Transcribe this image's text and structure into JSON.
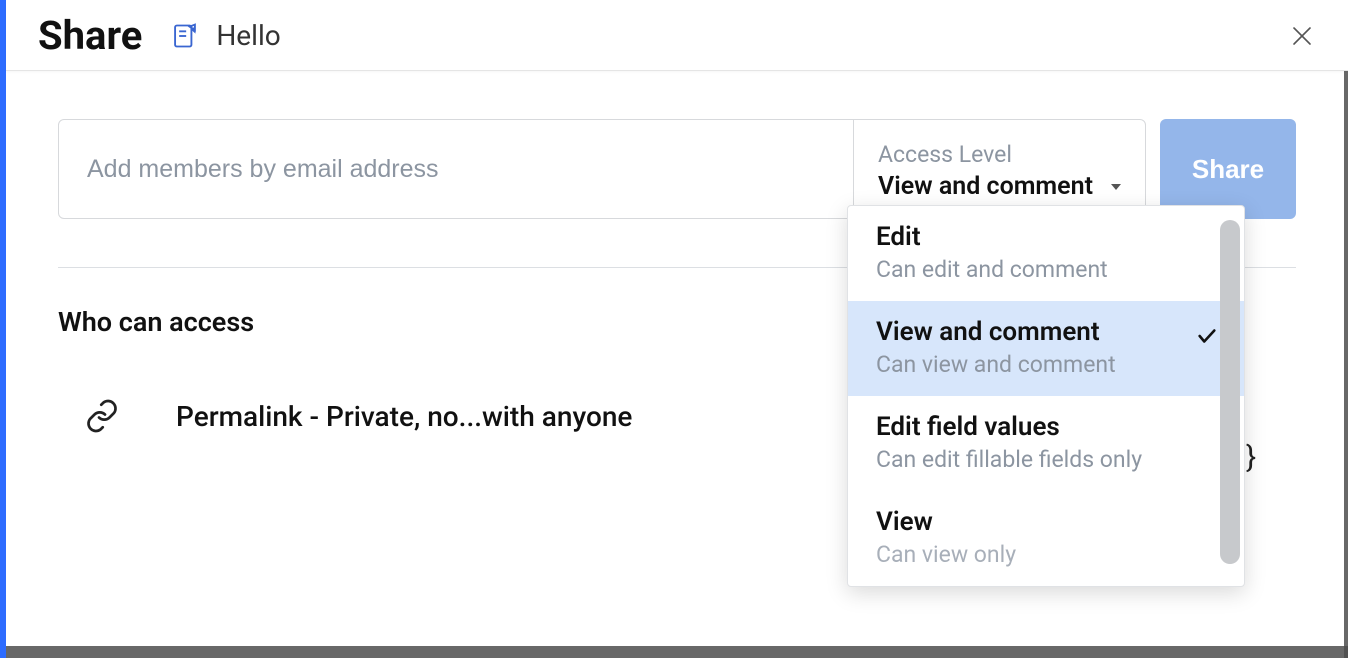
{
  "header": {
    "title": "Share",
    "doc_name": "Hello"
  },
  "input": {
    "placeholder": "Add members by email address",
    "access_label": "Access Level",
    "access_value": "View and comment"
  },
  "share_button": "Share",
  "who_label": "Who can access",
  "permalink": "Permalink - Private, no...with anyone",
  "dropdown": {
    "items": [
      {
        "title": "Edit",
        "desc": "Can edit and comment"
      },
      {
        "title": "View and comment",
        "desc": "Can view and comment"
      },
      {
        "title": "Edit field values",
        "desc": "Can edit fillable fields only"
      },
      {
        "title": "View",
        "desc": "Can view only"
      }
    ],
    "selected_index": 1
  },
  "brace": "}"
}
